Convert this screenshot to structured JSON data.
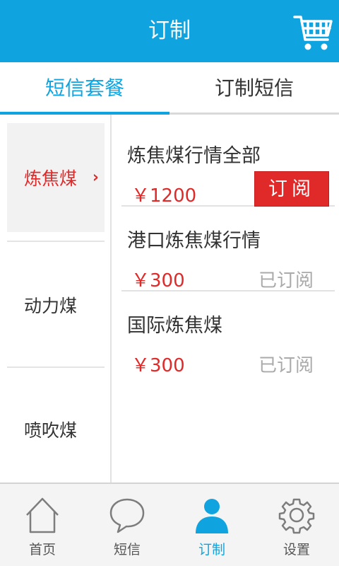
{
  "header": {
    "title": "订制",
    "cart_icon": "shopping-cart-icon"
  },
  "tabs": [
    {
      "label": "短信套餐",
      "active": true
    },
    {
      "label": "订制短信",
      "active": false
    }
  ],
  "sidebar": {
    "items": [
      {
        "label": "炼焦煤",
        "active": true
      },
      {
        "label": "动力煤",
        "active": false
      },
      {
        "label": "喷吹煤",
        "active": false
      }
    ],
    "chevron": "›"
  },
  "content": {
    "items": [
      {
        "title": "炼焦煤行情全部",
        "price": "￥1200",
        "action": "订阅",
        "subscribed": false
      },
      {
        "title": "港口炼焦煤行情",
        "price": "￥300",
        "action": "已订阅",
        "subscribed": true
      },
      {
        "title": "国际炼焦煤",
        "price": "￥300",
        "action": "已订阅",
        "subscribed": true
      }
    ]
  },
  "bottom_nav": {
    "items": [
      {
        "label": "首页",
        "icon": "home-icon",
        "active": false
      },
      {
        "label": "短信",
        "icon": "chat-bubble-icon",
        "active": false
      },
      {
        "label": "订制",
        "icon": "person-icon",
        "active": true
      },
      {
        "label": "设置",
        "icon": "gear-icon",
        "active": false
      }
    ]
  },
  "colors": {
    "primary": "#0fa4df",
    "accent_red": "#e02a2a",
    "muted": "#aaaaaa"
  }
}
